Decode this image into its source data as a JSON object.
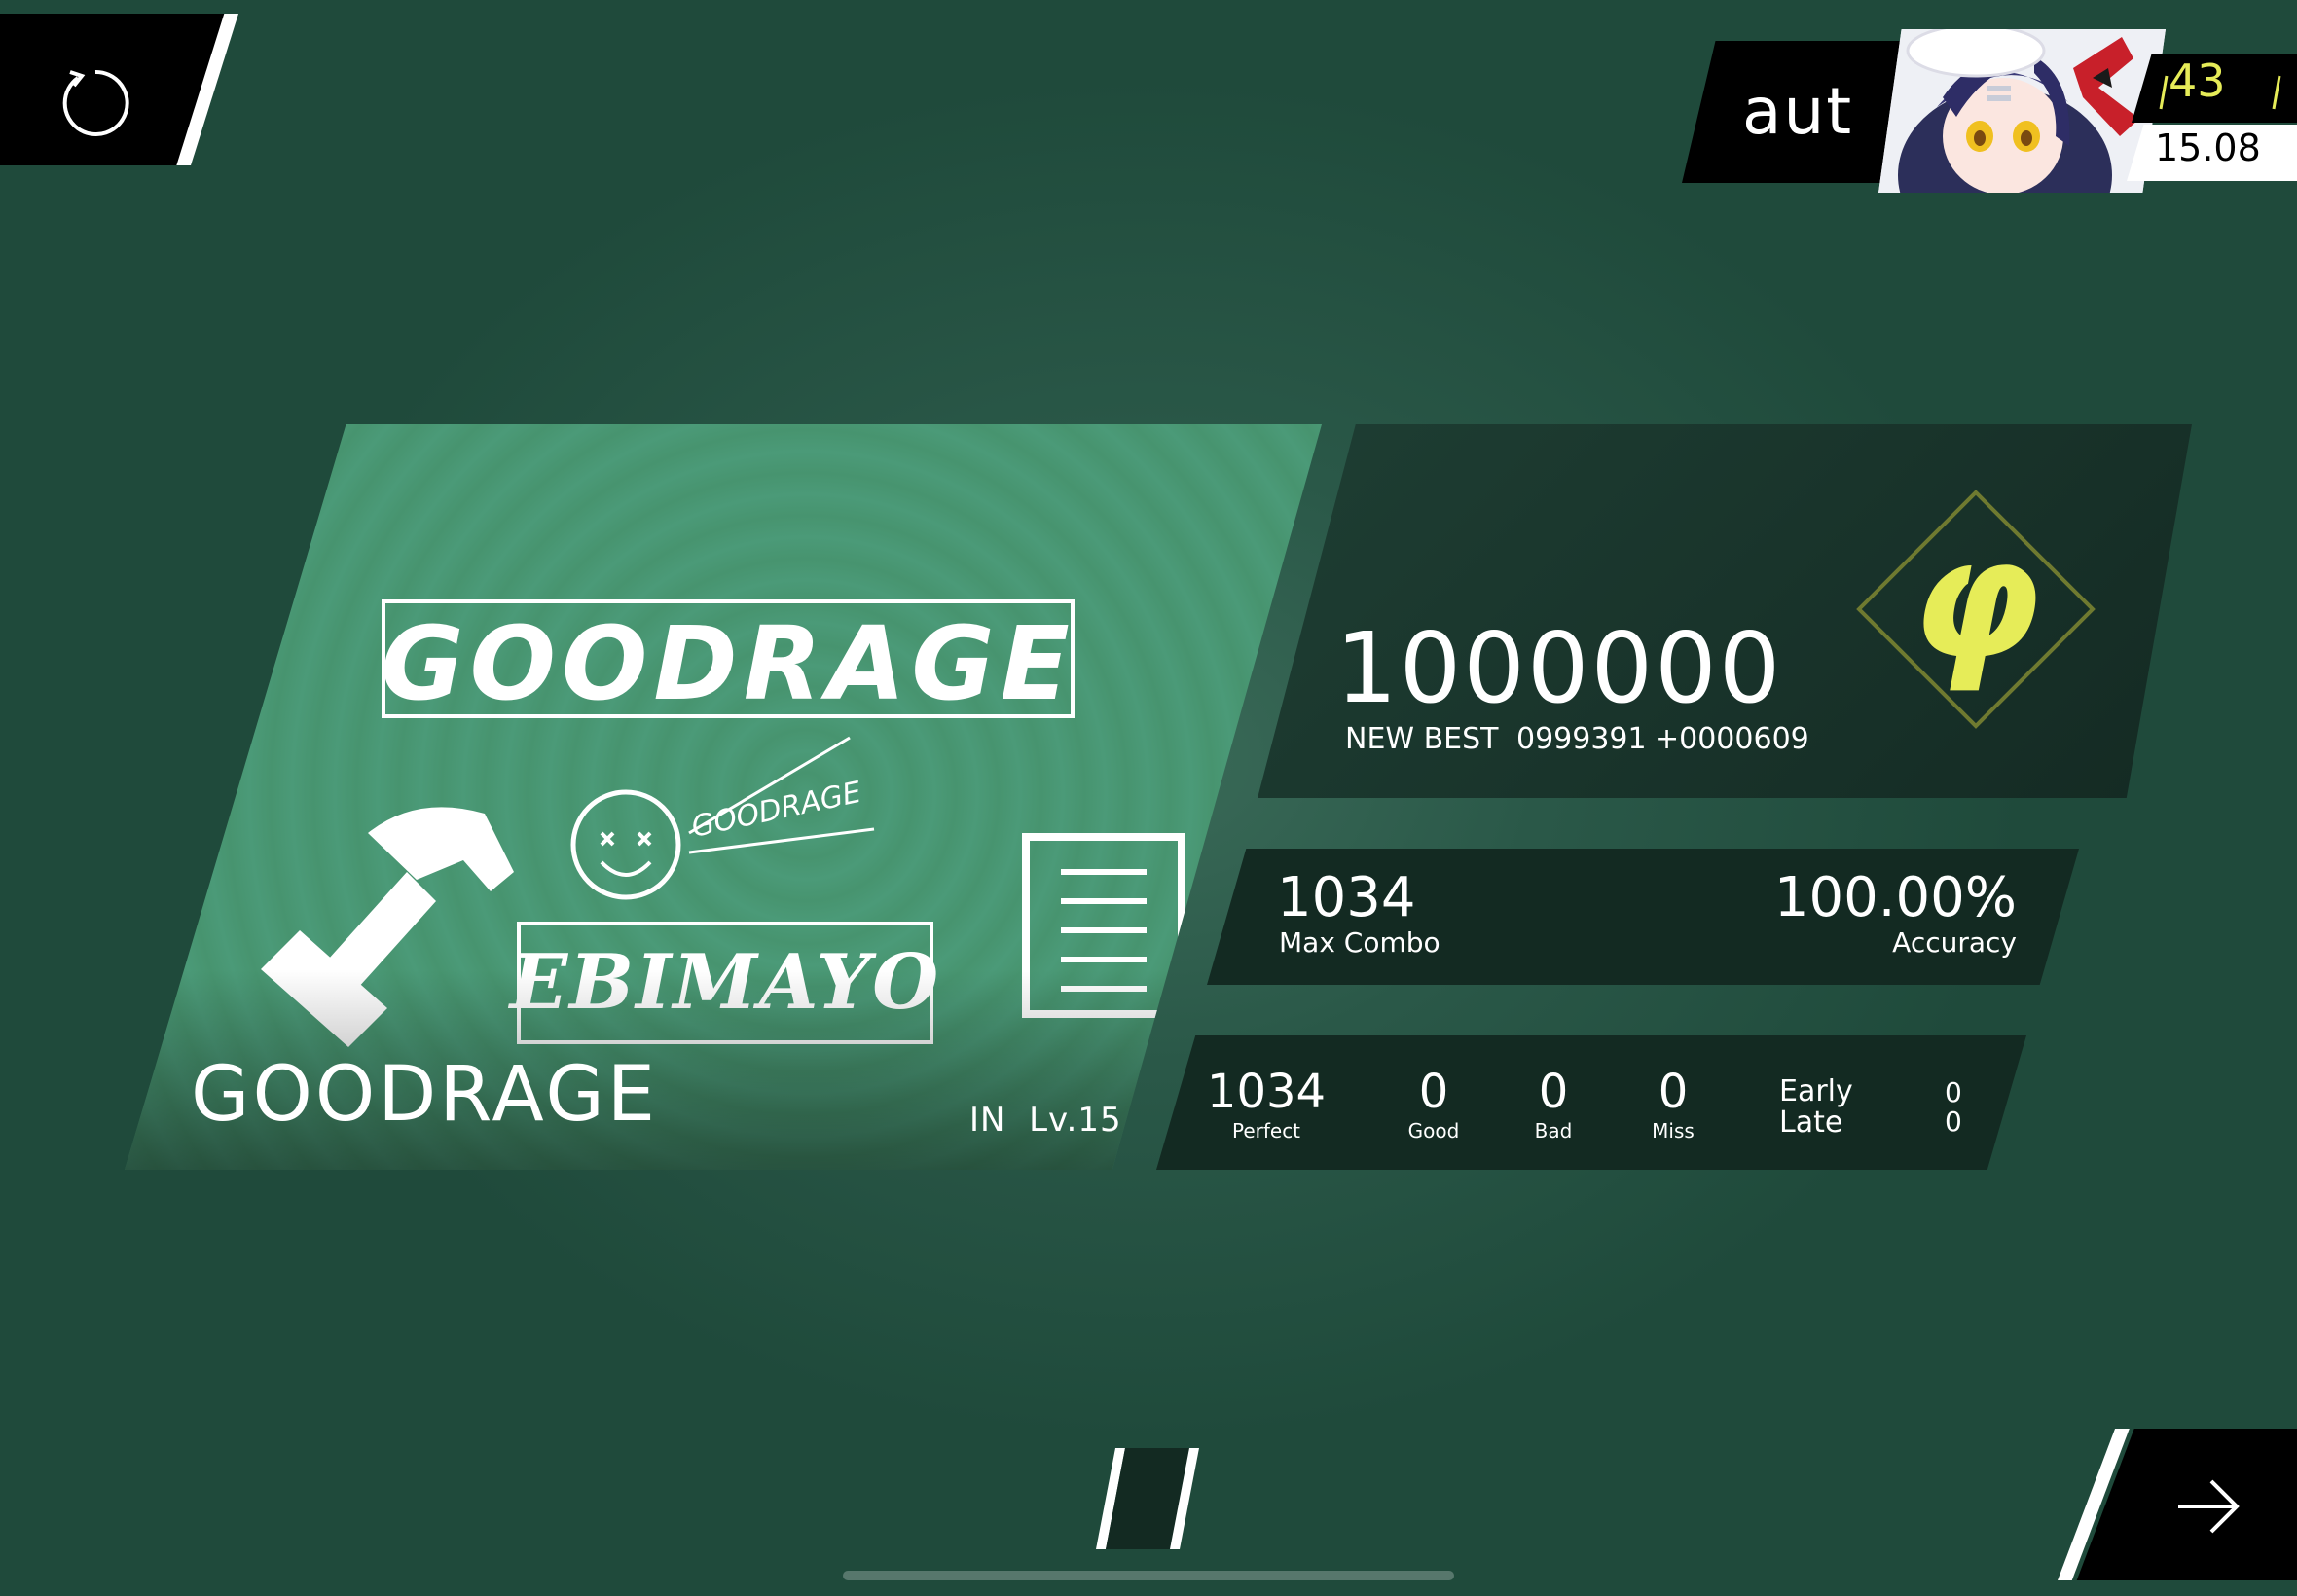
{
  "retry": {
    "icon": "retry-icon"
  },
  "player": {
    "name": "aut",
    "rank": "43",
    "rks": "15.08",
    "avatar_icon": "avatar-illustration"
  },
  "song": {
    "title": "GOODRAGE",
    "difficulty": "IN",
    "level": "Lv.15",
    "art": {
      "title_logo": "GOODRAGE",
      "small_logo": "GOODRAGE",
      "artist_logo": "EBIMAYO"
    }
  },
  "score": {
    "value": "1000000",
    "new_best_label": "NEW BEST",
    "previous_best": "0999391",
    "difference": "+0000609",
    "grade": "φ",
    "grade_color": "#e6ec58"
  },
  "combo": {
    "max_combo_value": "1034",
    "max_combo_label": "Max Combo",
    "accuracy_value": "100.00%",
    "accuracy_label": "Accuracy"
  },
  "judgements": {
    "perfect": {
      "value": "1034",
      "label": "Perfect"
    },
    "good": {
      "value": "0",
      "label": "Good"
    },
    "bad": {
      "value": "0",
      "label": "Bad"
    },
    "miss": {
      "value": "0",
      "label": "Miss"
    },
    "early_label": "Early",
    "late_label": "Late",
    "early_value": "0",
    "late_value": "0"
  },
  "next": {
    "icon": "arrow-right-icon"
  },
  "colors": {
    "background": "#2a5848",
    "card": "#4b9a78",
    "panel": "#132a22",
    "accent": "#e6ec58"
  }
}
